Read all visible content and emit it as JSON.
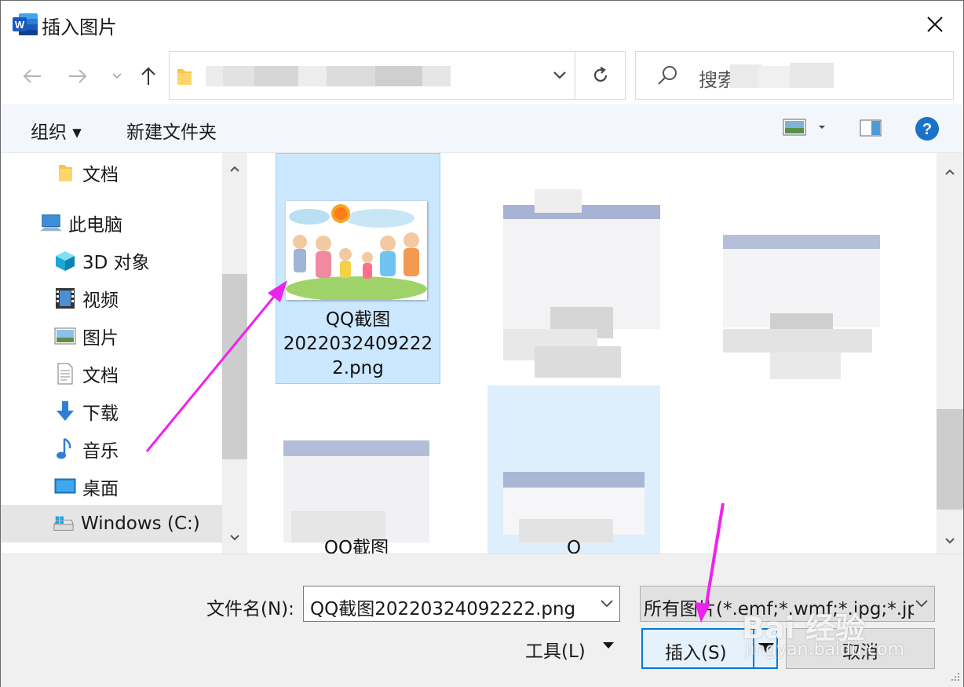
{
  "window": {
    "title": "插入图片",
    "app_icon": "word-icon"
  },
  "nav": {
    "back": "back-arrow-icon",
    "forward": "forward-arrow-icon",
    "recent": "chevron-down-icon",
    "up": "up-arrow-icon",
    "refresh": "refresh-icon"
  },
  "search": {
    "placeholder": "搜索"
  },
  "toolbar": {
    "organize": "组织 ▾",
    "new_folder": "新建文件夹"
  },
  "tree": {
    "items": [
      {
        "label": "文档",
        "icon": "folder-icon"
      },
      {
        "label": "此电脑",
        "icon": "computer-icon"
      },
      {
        "label": "3D 对象",
        "icon": "cube-icon"
      },
      {
        "label": "视频",
        "icon": "video-icon"
      },
      {
        "label": "图片",
        "icon": "picture-icon"
      },
      {
        "label": "文档",
        "icon": "document-icon"
      },
      {
        "label": "下载",
        "icon": "download-icon"
      },
      {
        "label": "音乐",
        "icon": "music-icon"
      },
      {
        "label": "桌面",
        "icon": "desktop-icon"
      },
      {
        "label": "Windows (C:)",
        "icon": "drive-icon"
      }
    ]
  },
  "files": [
    {
      "line1": "QQ截图",
      "line2": "2022032409222",
      "line3": "2.png",
      "selected": true
    },
    {
      "line1": "QQ截图",
      "line2": "",
      "line3": ""
    },
    {
      "line1": "Q",
      "line2": "",
      "line3": ""
    }
  ],
  "bottom": {
    "filename_label": "文件名(N):",
    "filename_value": "QQ截图20220324092222.png",
    "filetype_value": "所有图片(*.emf;*.wmf;*.jpg;*.jp",
    "tools_label": "工具(L)",
    "insert_label": "插入(S)",
    "cancel_label": "取消"
  },
  "colors": {
    "accent": "#0078d7",
    "selection": "#cce8ff",
    "annotation": "#ee22ee",
    "help": "#1a73c8"
  },
  "watermark": {
    "line1": "Bai 经验",
    "line2": "jingyan.baidu.com"
  }
}
